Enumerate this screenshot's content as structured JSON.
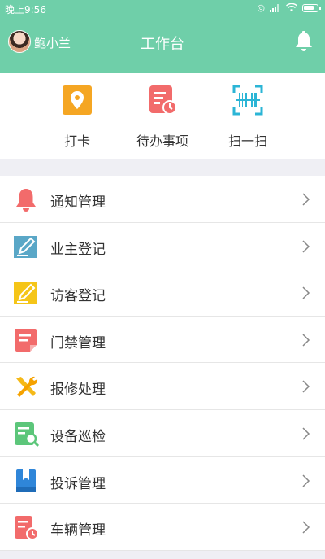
{
  "status_bar": {
    "time": "晚上9:56"
  },
  "header": {
    "username": "鲍小兰",
    "title": "工作台"
  },
  "quick_actions": [
    {
      "label": "打卡",
      "icon": "location-pin-icon",
      "color": "#f5a623"
    },
    {
      "label": "待办事项",
      "icon": "todo-list-icon",
      "color": "#f26b6b"
    },
    {
      "label": "扫一扫",
      "icon": "barcode-scan-icon",
      "color": "#2bb5d6"
    }
  ],
  "menu": [
    {
      "label": "通知管理",
      "icon": "bell-icon",
      "color": "#f26b6b"
    },
    {
      "label": "业主登记",
      "icon": "edit-document-icon",
      "color": "#5aa7c7"
    },
    {
      "label": "访客登记",
      "icon": "edit-document-icon",
      "color": "#f5c518"
    },
    {
      "label": "门禁管理",
      "icon": "document-icon",
      "color": "#f26b6b"
    },
    {
      "label": "报修处理",
      "icon": "wrench-screwdriver-icon",
      "color": "#f5b918"
    },
    {
      "label": "设备巡检",
      "icon": "document-search-icon",
      "color": "#5cc67a"
    },
    {
      "label": "投诉管理",
      "icon": "bookmark-book-icon",
      "color": "#2f86d9"
    },
    {
      "label": "车辆管理",
      "icon": "document-clock-icon",
      "color": "#f26b6b"
    }
  ]
}
